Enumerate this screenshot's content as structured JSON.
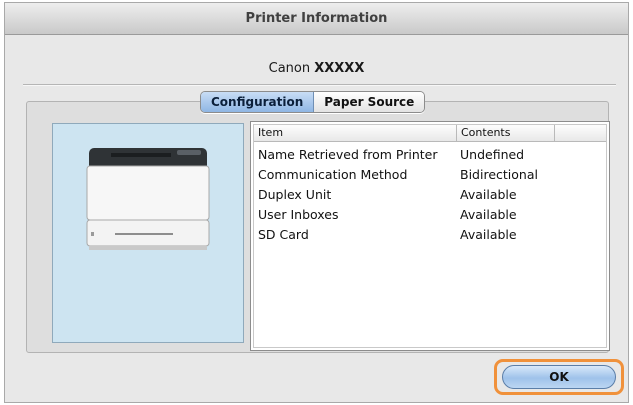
{
  "window": {
    "title": "Printer Information"
  },
  "printer": {
    "name_prefix": "Canon ",
    "name_model": "XXXXX"
  },
  "tabs": [
    {
      "label": "Configuration",
      "selected": true
    },
    {
      "label": "Paper Source",
      "selected": false
    }
  ],
  "list": {
    "columns": [
      "Item",
      "Contents"
    ],
    "rows": [
      {
        "item": "Name Retrieved from Printer",
        "contents": "Undefined"
      },
      {
        "item": "Communication Method",
        "contents": "Bidirectional"
      },
      {
        "item": "Duplex Unit",
        "contents": "Available"
      },
      {
        "item": "User Inboxes",
        "contents": "Available"
      },
      {
        "item": "SD Card",
        "contents": "Available"
      }
    ]
  },
  "buttons": {
    "ok_label": "OK"
  },
  "colors": {
    "focus_ring": "#f0913b",
    "image_panel_bg": "#cde4f1",
    "tab_selected": "#8fb6e4"
  },
  "icons": {
    "printer_image": "printer-icon"
  }
}
